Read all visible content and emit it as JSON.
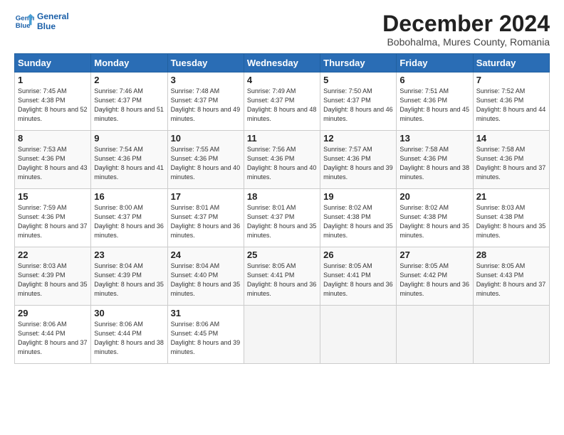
{
  "header": {
    "logo_line1": "General",
    "logo_line2": "Blue",
    "title": "December 2024",
    "subtitle": "Bobohalma, Mures County, Romania"
  },
  "columns": [
    "Sunday",
    "Monday",
    "Tuesday",
    "Wednesday",
    "Thursday",
    "Friday",
    "Saturday"
  ],
  "weeks": [
    [
      {
        "day": "1",
        "sunrise": "7:45 AM",
        "sunset": "4:38 PM",
        "daylight": "8 hours and 52 minutes."
      },
      {
        "day": "2",
        "sunrise": "7:46 AM",
        "sunset": "4:37 PM",
        "daylight": "8 hours and 51 minutes."
      },
      {
        "day": "3",
        "sunrise": "7:48 AM",
        "sunset": "4:37 PM",
        "daylight": "8 hours and 49 minutes."
      },
      {
        "day": "4",
        "sunrise": "7:49 AM",
        "sunset": "4:37 PM",
        "daylight": "8 hours and 48 minutes."
      },
      {
        "day": "5",
        "sunrise": "7:50 AM",
        "sunset": "4:37 PM",
        "daylight": "8 hours and 46 minutes."
      },
      {
        "day": "6",
        "sunrise": "7:51 AM",
        "sunset": "4:36 PM",
        "daylight": "8 hours and 45 minutes."
      },
      {
        "day": "7",
        "sunrise": "7:52 AM",
        "sunset": "4:36 PM",
        "daylight": "8 hours and 44 minutes."
      }
    ],
    [
      {
        "day": "8",
        "sunrise": "7:53 AM",
        "sunset": "4:36 PM",
        "daylight": "8 hours and 43 minutes."
      },
      {
        "day": "9",
        "sunrise": "7:54 AM",
        "sunset": "4:36 PM",
        "daylight": "8 hours and 41 minutes."
      },
      {
        "day": "10",
        "sunrise": "7:55 AM",
        "sunset": "4:36 PM",
        "daylight": "8 hours and 40 minutes."
      },
      {
        "day": "11",
        "sunrise": "7:56 AM",
        "sunset": "4:36 PM",
        "daylight": "8 hours and 40 minutes."
      },
      {
        "day": "12",
        "sunrise": "7:57 AM",
        "sunset": "4:36 PM",
        "daylight": "8 hours and 39 minutes."
      },
      {
        "day": "13",
        "sunrise": "7:58 AM",
        "sunset": "4:36 PM",
        "daylight": "8 hours and 38 minutes."
      },
      {
        "day": "14",
        "sunrise": "7:58 AM",
        "sunset": "4:36 PM",
        "daylight": "8 hours and 37 minutes."
      }
    ],
    [
      {
        "day": "15",
        "sunrise": "7:59 AM",
        "sunset": "4:36 PM",
        "daylight": "8 hours and 37 minutes."
      },
      {
        "day": "16",
        "sunrise": "8:00 AM",
        "sunset": "4:37 PM",
        "daylight": "8 hours and 36 minutes."
      },
      {
        "day": "17",
        "sunrise": "8:01 AM",
        "sunset": "4:37 PM",
        "daylight": "8 hours and 36 minutes."
      },
      {
        "day": "18",
        "sunrise": "8:01 AM",
        "sunset": "4:37 PM",
        "daylight": "8 hours and 35 minutes."
      },
      {
        "day": "19",
        "sunrise": "8:02 AM",
        "sunset": "4:38 PM",
        "daylight": "8 hours and 35 minutes."
      },
      {
        "day": "20",
        "sunrise": "8:02 AM",
        "sunset": "4:38 PM",
        "daylight": "8 hours and 35 minutes."
      },
      {
        "day": "21",
        "sunrise": "8:03 AM",
        "sunset": "4:38 PM",
        "daylight": "8 hours and 35 minutes."
      }
    ],
    [
      {
        "day": "22",
        "sunrise": "8:03 AM",
        "sunset": "4:39 PM",
        "daylight": "8 hours and 35 minutes."
      },
      {
        "day": "23",
        "sunrise": "8:04 AM",
        "sunset": "4:39 PM",
        "daylight": "8 hours and 35 minutes."
      },
      {
        "day": "24",
        "sunrise": "8:04 AM",
        "sunset": "4:40 PM",
        "daylight": "8 hours and 35 minutes."
      },
      {
        "day": "25",
        "sunrise": "8:05 AM",
        "sunset": "4:41 PM",
        "daylight": "8 hours and 36 minutes."
      },
      {
        "day": "26",
        "sunrise": "8:05 AM",
        "sunset": "4:41 PM",
        "daylight": "8 hours and 36 minutes."
      },
      {
        "day": "27",
        "sunrise": "8:05 AM",
        "sunset": "4:42 PM",
        "daylight": "8 hours and 36 minutes."
      },
      {
        "day": "28",
        "sunrise": "8:05 AM",
        "sunset": "4:43 PM",
        "daylight": "8 hours and 37 minutes."
      }
    ],
    [
      {
        "day": "29",
        "sunrise": "8:06 AM",
        "sunset": "4:44 PM",
        "daylight": "8 hours and 37 minutes."
      },
      {
        "day": "30",
        "sunrise": "8:06 AM",
        "sunset": "4:44 PM",
        "daylight": "8 hours and 38 minutes."
      },
      {
        "day": "31",
        "sunrise": "8:06 AM",
        "sunset": "4:45 PM",
        "daylight": "8 hours and 39 minutes."
      },
      null,
      null,
      null,
      null
    ]
  ]
}
